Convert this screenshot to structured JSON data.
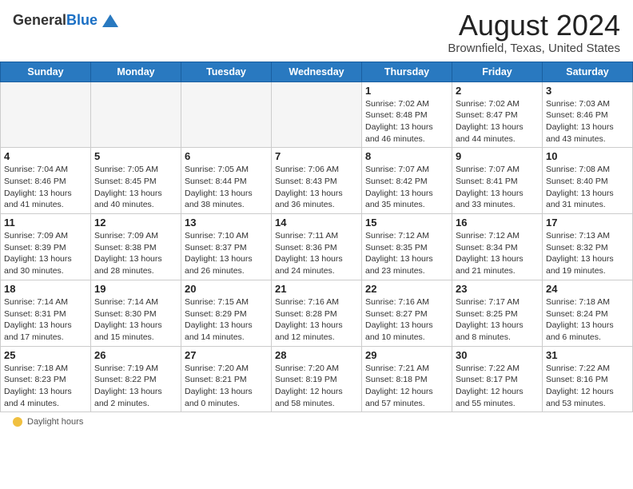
{
  "header": {
    "logo_line1": "General",
    "logo_line2": "Blue",
    "main_title": "August 2024",
    "subtitle": "Brownfield, Texas, United States"
  },
  "calendar": {
    "days_of_week": [
      "Sunday",
      "Monday",
      "Tuesday",
      "Wednesday",
      "Thursday",
      "Friday",
      "Saturday"
    ],
    "weeks": [
      [
        {
          "day": "",
          "info": ""
        },
        {
          "day": "",
          "info": ""
        },
        {
          "day": "",
          "info": ""
        },
        {
          "day": "",
          "info": ""
        },
        {
          "day": "1",
          "info": "Sunrise: 7:02 AM\nSunset: 8:48 PM\nDaylight: 13 hours and 46 minutes."
        },
        {
          "day": "2",
          "info": "Sunrise: 7:02 AM\nSunset: 8:47 PM\nDaylight: 13 hours and 44 minutes."
        },
        {
          "day": "3",
          "info": "Sunrise: 7:03 AM\nSunset: 8:46 PM\nDaylight: 13 hours and 43 minutes."
        }
      ],
      [
        {
          "day": "4",
          "info": "Sunrise: 7:04 AM\nSunset: 8:46 PM\nDaylight: 13 hours and 41 minutes."
        },
        {
          "day": "5",
          "info": "Sunrise: 7:05 AM\nSunset: 8:45 PM\nDaylight: 13 hours and 40 minutes."
        },
        {
          "day": "6",
          "info": "Sunrise: 7:05 AM\nSunset: 8:44 PM\nDaylight: 13 hours and 38 minutes."
        },
        {
          "day": "7",
          "info": "Sunrise: 7:06 AM\nSunset: 8:43 PM\nDaylight: 13 hours and 36 minutes."
        },
        {
          "day": "8",
          "info": "Sunrise: 7:07 AM\nSunset: 8:42 PM\nDaylight: 13 hours and 35 minutes."
        },
        {
          "day": "9",
          "info": "Sunrise: 7:07 AM\nSunset: 8:41 PM\nDaylight: 13 hours and 33 minutes."
        },
        {
          "day": "10",
          "info": "Sunrise: 7:08 AM\nSunset: 8:40 PM\nDaylight: 13 hours and 31 minutes."
        }
      ],
      [
        {
          "day": "11",
          "info": "Sunrise: 7:09 AM\nSunset: 8:39 PM\nDaylight: 13 hours and 30 minutes."
        },
        {
          "day": "12",
          "info": "Sunrise: 7:09 AM\nSunset: 8:38 PM\nDaylight: 13 hours and 28 minutes."
        },
        {
          "day": "13",
          "info": "Sunrise: 7:10 AM\nSunset: 8:37 PM\nDaylight: 13 hours and 26 minutes."
        },
        {
          "day": "14",
          "info": "Sunrise: 7:11 AM\nSunset: 8:36 PM\nDaylight: 13 hours and 24 minutes."
        },
        {
          "day": "15",
          "info": "Sunrise: 7:12 AM\nSunset: 8:35 PM\nDaylight: 13 hours and 23 minutes."
        },
        {
          "day": "16",
          "info": "Sunrise: 7:12 AM\nSunset: 8:34 PM\nDaylight: 13 hours and 21 minutes."
        },
        {
          "day": "17",
          "info": "Sunrise: 7:13 AM\nSunset: 8:32 PM\nDaylight: 13 hours and 19 minutes."
        }
      ],
      [
        {
          "day": "18",
          "info": "Sunrise: 7:14 AM\nSunset: 8:31 PM\nDaylight: 13 hours and 17 minutes."
        },
        {
          "day": "19",
          "info": "Sunrise: 7:14 AM\nSunset: 8:30 PM\nDaylight: 13 hours and 15 minutes."
        },
        {
          "day": "20",
          "info": "Sunrise: 7:15 AM\nSunset: 8:29 PM\nDaylight: 13 hours and 14 minutes."
        },
        {
          "day": "21",
          "info": "Sunrise: 7:16 AM\nSunset: 8:28 PM\nDaylight: 13 hours and 12 minutes."
        },
        {
          "day": "22",
          "info": "Sunrise: 7:16 AM\nSunset: 8:27 PM\nDaylight: 13 hours and 10 minutes."
        },
        {
          "day": "23",
          "info": "Sunrise: 7:17 AM\nSunset: 8:25 PM\nDaylight: 13 hours and 8 minutes."
        },
        {
          "day": "24",
          "info": "Sunrise: 7:18 AM\nSunset: 8:24 PM\nDaylight: 13 hours and 6 minutes."
        }
      ],
      [
        {
          "day": "25",
          "info": "Sunrise: 7:18 AM\nSunset: 8:23 PM\nDaylight: 13 hours and 4 minutes."
        },
        {
          "day": "26",
          "info": "Sunrise: 7:19 AM\nSunset: 8:22 PM\nDaylight: 13 hours and 2 minutes."
        },
        {
          "day": "27",
          "info": "Sunrise: 7:20 AM\nSunset: 8:21 PM\nDaylight: 13 hours and 0 minutes."
        },
        {
          "day": "28",
          "info": "Sunrise: 7:20 AM\nSunset: 8:19 PM\nDaylight: 12 hours and 58 minutes."
        },
        {
          "day": "29",
          "info": "Sunrise: 7:21 AM\nSunset: 8:18 PM\nDaylight: 12 hours and 57 minutes."
        },
        {
          "day": "30",
          "info": "Sunrise: 7:22 AM\nSunset: 8:17 PM\nDaylight: 12 hours and 55 minutes."
        },
        {
          "day": "31",
          "info": "Sunrise: 7:22 AM\nSunset: 8:16 PM\nDaylight: 12 hours and 53 minutes."
        }
      ]
    ]
  },
  "footer": {
    "label": "Daylight hours"
  }
}
